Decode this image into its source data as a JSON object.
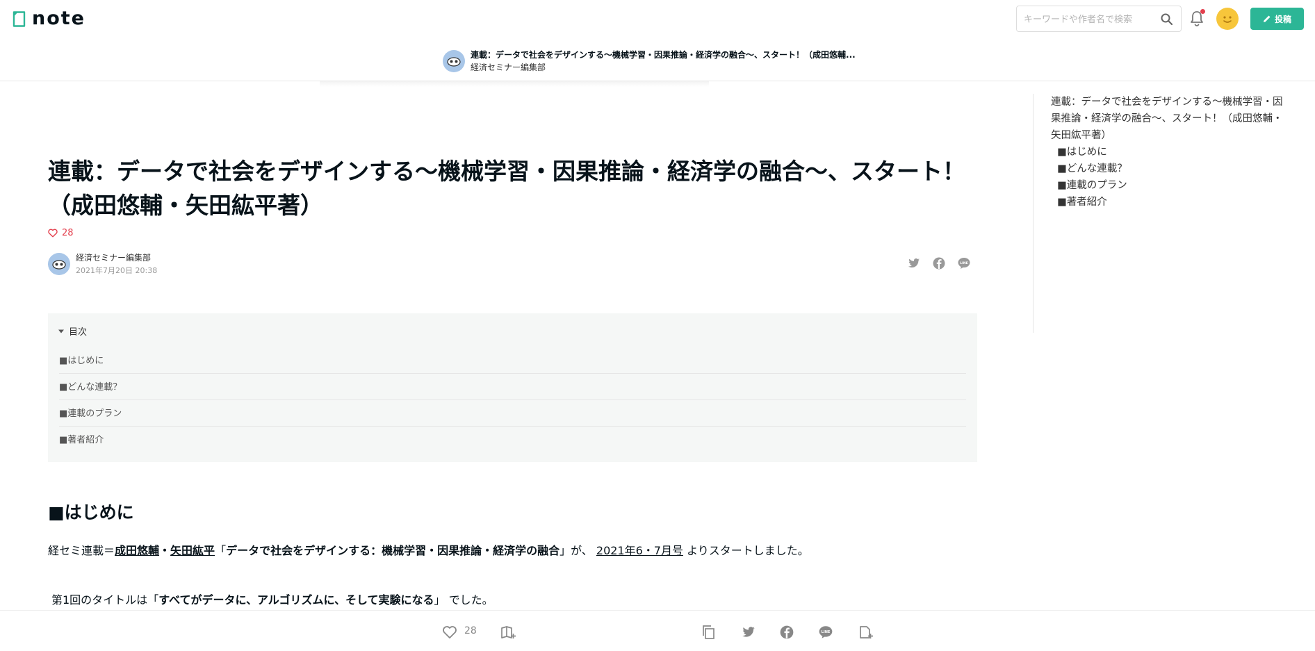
{
  "header": {
    "logo_text": "note",
    "search_placeholder": "キーワードや作者名で検索",
    "post_button_label": "投稿",
    "brand_color": "#2cb696",
    "notification_dot_color": "#e33f4d",
    "icons": [
      "search-icon",
      "bell-icon",
      "pencil-icon"
    ]
  },
  "subheader": {
    "title": "連載：データで社会をデザインする〜機械学習・因果推論・経済学の融合〜、スタート！（成田悠輔...",
    "author": "経済セミナー編集部"
  },
  "article": {
    "title": "連載：データで社会をデザインする〜機械学習・因果推論・経済学の融合〜、スタート！（成田悠輔・矢田紘平著）",
    "like_count": "28",
    "author_name": "経済セミナー編集部",
    "published_at": "2021年7月20日 20:38",
    "share_icons": [
      "twitter-icon",
      "facebook-icon",
      "line-icon"
    ]
  },
  "toc": {
    "label": "目次",
    "items": [
      {
        "label": "■はじめに"
      },
      {
        "label": "■どんな連載？"
      },
      {
        "label": "■連載のプラン"
      },
      {
        "label": "■著者紹介"
      }
    ]
  },
  "body": {
    "section_heading": "■はじめに",
    "p1": {
      "prefix": "経セミ連載＝",
      "author1": "成田悠輔",
      "sep": "・",
      "author2": "矢田紘平",
      "quote_open": "「",
      "series_title": "データで社会をデザインする：機械学習・因果推論・経済学の融合",
      "quote_close": "」",
      "mid": "が、 ",
      "issue_link": "2021年6・7月号",
      "suffix": " よりスタートしました。"
    },
    "p2": {
      "prefix": "第1回のタイトルは",
      "quote_open": "「",
      "ep_title": "すべてがデータに、アルゴリズムに、そして実験になる",
      "quote_close": "」",
      "suffix": " でした。"
    }
  },
  "sidebar_toc": {
    "title": "連載：データで社会をデザインする〜機械学習・因果推論・経済学の融合〜、スタート！（成田悠輔・矢田紘平著）",
    "items": [
      {
        "label": "■はじめに"
      },
      {
        "label": "■どんな連載？"
      },
      {
        "label": "■連載のプラン"
      },
      {
        "label": "■著者紹介"
      }
    ]
  },
  "bottom_bar": {
    "like_count": "28",
    "icons": [
      "heart-icon",
      "magazine-add-icon",
      "copy-link-icon",
      "twitter-icon",
      "facebook-icon",
      "line-icon",
      "embed-icon"
    ]
  }
}
